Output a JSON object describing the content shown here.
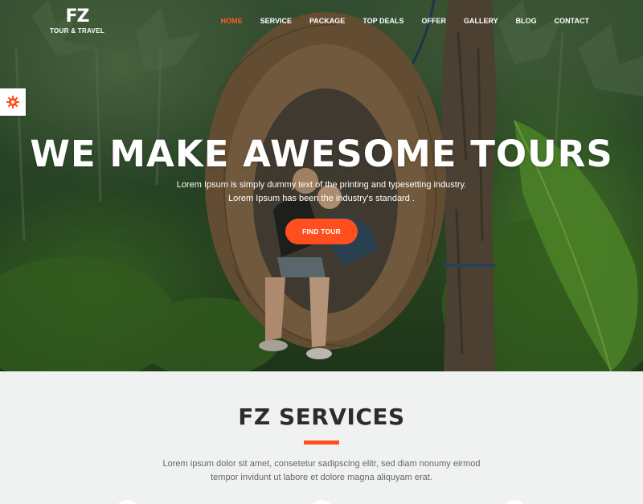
{
  "brand": {
    "mark": "FZ",
    "subtitle": "TOUR & TRAVEL"
  },
  "nav": {
    "items": [
      {
        "label": "HOME"
      },
      {
        "label": "SERVICE"
      },
      {
        "label": "PACKAGE"
      },
      {
        "label": "TOP DEALS"
      },
      {
        "label": "OFFER"
      },
      {
        "label": "GALLERY"
      },
      {
        "label": "BLOG"
      },
      {
        "label": "CONTACT"
      }
    ],
    "active_index": 0
  },
  "settings": {
    "icon": "gear-icon"
  },
  "hero": {
    "title": "WE MAKE AWESOME TOURS",
    "text_line1": "Lorem Ipsum is simply dummy text of the printing and typesetting industry.",
    "text_line2": "Lorem Ipsum has been the industry's standard .",
    "button_label": "FIND TOUR"
  },
  "services": {
    "title": "FZ SERVICES",
    "text_line1": "Lorem ipsum dolor sit amet, consetetur sadipscing elitr, sed diam nonumy eirmod",
    "text_line2": "tempor invidunt ut labore et dolore magna aliquyam erat."
  },
  "colors": {
    "accent": "#ff4f1e",
    "section_bg": "#f0f2f2",
    "heading": "#2c2c2c"
  }
}
